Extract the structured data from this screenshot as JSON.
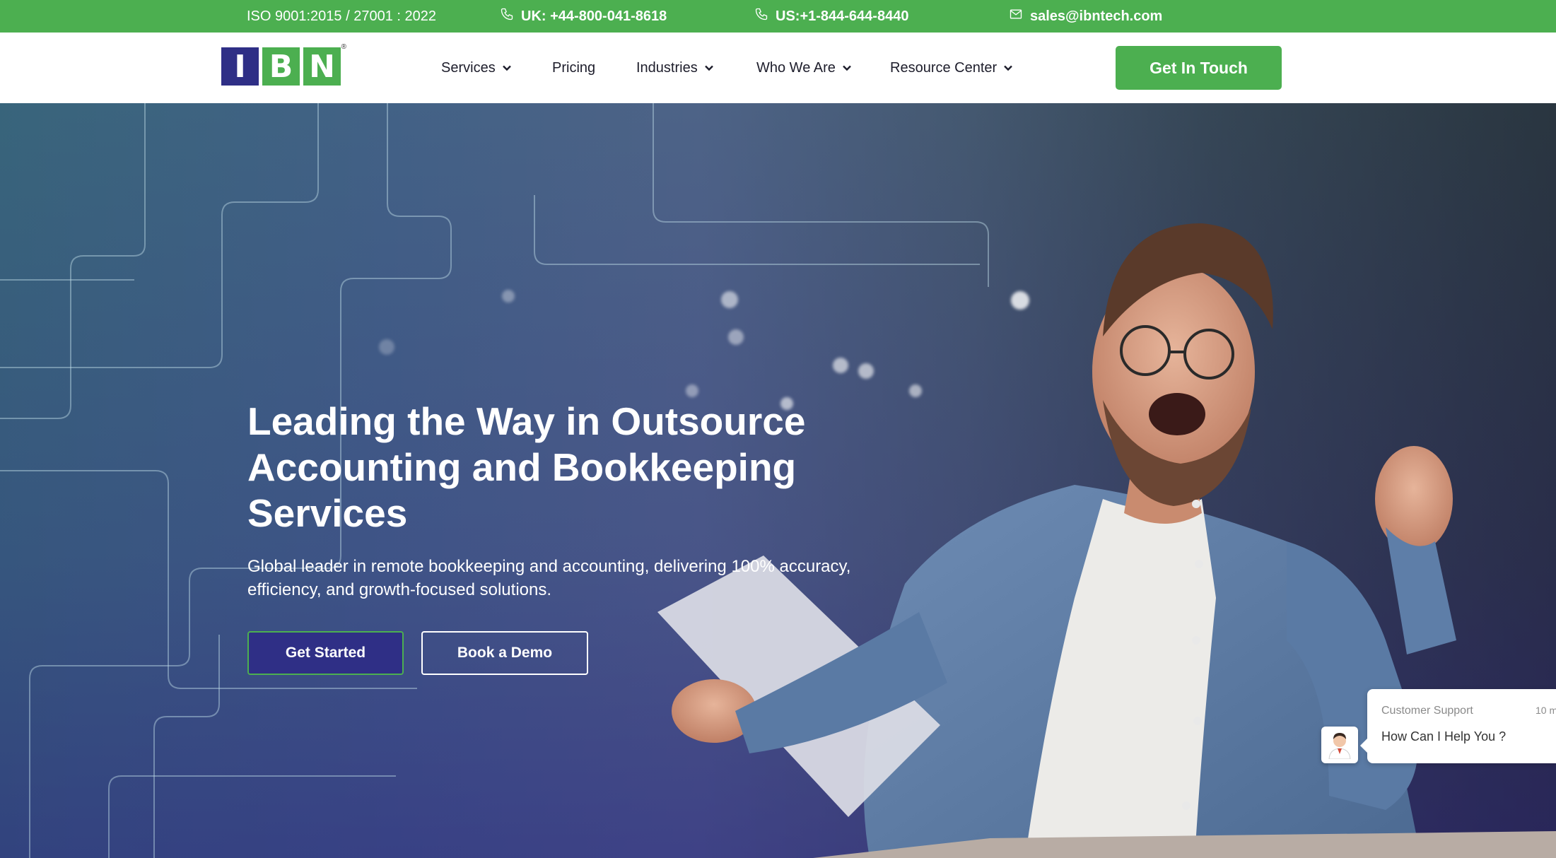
{
  "topbar": {
    "iso": "ISO 9001:2015 / 27001 : 2022",
    "uk_phone": "UK: +44-800-041-8618",
    "us_phone": "US:+1-844-644-8440",
    "email": "sales@ibntech.com"
  },
  "logo": {
    "letters": [
      "I",
      "B",
      "N"
    ],
    "registered": "®"
  },
  "nav": {
    "items": [
      {
        "label": "Services",
        "has_dropdown": true
      },
      {
        "label": "Pricing",
        "has_dropdown": false
      },
      {
        "label": "Industries",
        "has_dropdown": true
      },
      {
        "label": "Who We Are",
        "has_dropdown": true
      },
      {
        "label": "Resource Center",
        "has_dropdown": true
      }
    ],
    "cta_label": "Get In Touch"
  },
  "hero": {
    "title": "Leading the Way in Outsource Accounting and Bookkeeping Services",
    "subtitle": "Global leader in remote bookkeeping and accounting, delivering 100% accuracy, efficiency, and growth-focused solutions.",
    "primary_button": "Get Started",
    "secondary_button": "Book a Demo"
  },
  "chat": {
    "label": "Customer Support",
    "time": "10 m",
    "message": "How Can I Help You ?"
  },
  "colors": {
    "brand_green": "#4caf50",
    "brand_navy": "#2f2f86",
    "text_dark": "#1d1d2b"
  },
  "icons": [
    "phone-icon",
    "mail-icon",
    "chevron-down-icon",
    "support-agent-icon"
  ]
}
